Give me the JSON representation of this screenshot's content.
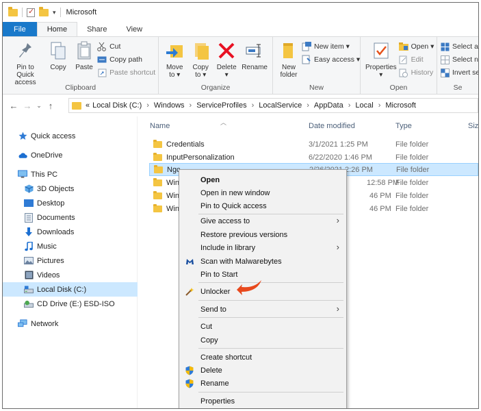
{
  "window": {
    "title": "Microsoft",
    "qa_dropdown": "▾"
  },
  "ribbon": {
    "tabs": [
      "File",
      "Home",
      "Share",
      "View"
    ],
    "clipboard": {
      "pin_line1": "Pin to Quick",
      "pin_line2": "access",
      "copy": "Copy",
      "paste": "Paste",
      "cut": "Cut",
      "copy_path": "Copy path",
      "paste_shortcut": "Paste shortcut",
      "label": "Clipboard"
    },
    "organize": {
      "move_line1": "Move",
      "move_line2": "to ▾",
      "copy_line1": "Copy",
      "copy_line2": "to ▾",
      "delete_line1": "Delete",
      "delete_line2": "▾",
      "rename": "Rename",
      "label": "Organize"
    },
    "new": {
      "new_folder_line1": "New",
      "new_folder_line2": "folder",
      "new_item": "New item ▾",
      "easy_access": "Easy access ▾",
      "label": "New"
    },
    "open": {
      "properties_line1": "Properties",
      "properties_line2": "▾",
      "open": "Open ▾",
      "edit": "Edit",
      "history": "History",
      "label": "Open"
    },
    "select": {
      "select_all": "Select all",
      "select_none": "Select none",
      "invert": "Invert selection",
      "label": "Se"
    }
  },
  "address": {
    "prefix": "«",
    "crumbs": [
      "Local Disk (C:)",
      "Windows",
      "ServiceProfiles",
      "LocalService",
      "AppData",
      "Local",
      "Microsoft"
    ],
    "separator": "›"
  },
  "nav": {
    "items": [
      {
        "label": "Quick access",
        "icon": "star-icon"
      },
      {
        "label": "OneDrive",
        "icon": "cloud-icon"
      },
      {
        "label": "This PC",
        "icon": "monitor-icon"
      },
      {
        "label": "3D Objects",
        "icon": "cube-icon"
      },
      {
        "label": "Desktop",
        "icon": "desktop-icon"
      },
      {
        "label": "Documents",
        "icon": "document-icon"
      },
      {
        "label": "Downloads",
        "icon": "download-icon"
      },
      {
        "label": "Music",
        "icon": "music-icon"
      },
      {
        "label": "Pictures",
        "icon": "pictures-icon"
      },
      {
        "label": "Videos",
        "icon": "video-icon"
      },
      {
        "label": "Local Disk (C:)",
        "icon": "drive-icon"
      },
      {
        "label": "CD Drive (E:) ESD-ISO",
        "icon": "cd-drive-icon"
      },
      {
        "label": "Network",
        "icon": "network-icon"
      }
    ],
    "selected": "Local Disk (C:)"
  },
  "files": {
    "columns": {
      "name": "Name",
      "date": "Date modified",
      "type": "Type",
      "size": "Size"
    },
    "rows": [
      {
        "name": "Credentials",
        "date": "3/1/2021 1:25 PM",
        "type": "File folder"
      },
      {
        "name": "InputPersonalization",
        "date": "6/22/2020 1:46 PM",
        "type": "File folder"
      },
      {
        "name": "Ngc",
        "date": "2/26/2021 2:26 PM",
        "type": "File folder"
      },
      {
        "name": "Win",
        "date": "12:58 PM",
        "type": "File folder"
      },
      {
        "name": "Win",
        "date": "46 PM",
        "type": "File folder"
      },
      {
        "name": "Win",
        "date": "46 PM",
        "type": "File folder"
      }
    ],
    "selected_index": 2
  },
  "context_menu": {
    "items": [
      {
        "label": "Open",
        "bold": true
      },
      {
        "label": "Open in new window"
      },
      {
        "label": "Pin to Quick access"
      },
      {
        "label": "Give access to",
        "submenu": true
      },
      {
        "label": "Restore previous versions"
      },
      {
        "label": "Include in library",
        "submenu": true
      },
      {
        "label": "Scan with Malwarebytes",
        "icon": "malwarebytes-icon"
      },
      {
        "label": "Pin to Start"
      },
      {
        "label": "Unlocker",
        "icon": "unlocker-wand-icon"
      },
      {
        "label": "Send to",
        "submenu": true
      },
      {
        "label": "Cut"
      },
      {
        "label": "Copy"
      },
      {
        "label": "Create shortcut"
      },
      {
        "label": "Delete",
        "icon": "shield-icon"
      },
      {
        "label": "Rename",
        "icon": "shield-icon"
      },
      {
        "label": "Properties"
      }
    ],
    "chevron": "›"
  },
  "colors": {
    "file_tab": "#1979ca",
    "selection": "#cce8ff",
    "folder": "#f4c542",
    "delete_red": "#e81123",
    "annotation_arrow": "#e8491d"
  }
}
